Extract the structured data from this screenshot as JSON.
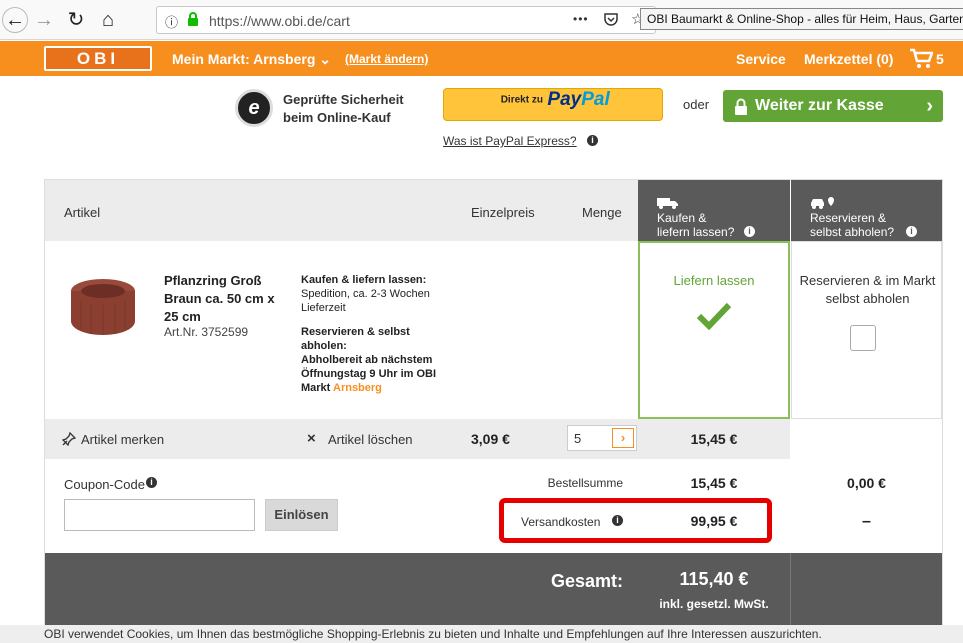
{
  "browser": {
    "url": "https://www.obi.de/cart",
    "tab_tooltip": "OBI Baumarkt & Online-Shop - alles für Heim, Haus, Garten",
    "back_glyph": "←",
    "forward_glyph": "→",
    "reload_glyph": "↻",
    "home_glyph": "⌂",
    "menu_glyph": "•••"
  },
  "header": {
    "logo_text": "OBI",
    "market_label": "Mein Markt: Arnsberg",
    "change_market": "(Markt ändern)",
    "service": "Service",
    "wishlist": "Merkzettel (0)",
    "cart_count": "5",
    "accent_color": "#f78f1e"
  },
  "checkout_bar": {
    "secure_text": "Geprüfte Sicherheit\nbeim Online-Kauf",
    "badge_letter": "e",
    "paypal_prefix": "Direkt zu",
    "paypal_brand_1": "Pay",
    "paypal_brand_2": "Pal",
    "paypal_link": "Was ist PayPal Express?",
    "oder": "oder",
    "checkout_label": "Weiter zur Kasse",
    "checkout_arrow": "›",
    "checkout_color": "#62a435"
  },
  "table": {
    "headers": {
      "artikel": "Artikel",
      "einzelpreis": "Einzelpreis",
      "menge": "Menge",
      "delivery_1": "Kaufen &",
      "delivery_2": "liefern lassen?",
      "pickup_1": "Reservieren &",
      "pickup_2": "selbst abholen?"
    },
    "product": {
      "name": "Pflanzring Groß Braun ca. 50 cm x 25 cm",
      "article_no": "Art.Nr. 3752599",
      "delivery_title": "Kaufen & liefern lassen:",
      "delivery_text": "Spedition, ca. 2-3 Wochen Lieferzeit",
      "pickup_title": "Reservieren & selbst abholen:",
      "pickup_text": "Abholbereit ab nächstem Öffnungstag 9 Uhr im OBI Markt",
      "pickup_market": "Arnsberg",
      "option_delivery": "Liefern lassen",
      "option_pickup": "Reservieren & im Markt selbst abholen",
      "delivery_selected": true
    },
    "actions": {
      "remember": "Artikel merken",
      "delete": "Artikel löschen",
      "unit_price": "3,09 €",
      "quantity": "5",
      "line_total": "15,45 €"
    },
    "summary": {
      "coupon_label": "Coupon-Code",
      "coupon_value": "",
      "redeem": "Einlösen",
      "order_sum_label": "Bestellsumme",
      "order_sum": "15,45 €",
      "pickup_sum": "0,00 €",
      "shipping_label": "Versandkosten",
      "shipping": "99,95 €",
      "pickup_shipping": "–",
      "total_label": "Gesamt:",
      "total": "115,40 €",
      "vat_note": "inkl. gesetzl. MwSt."
    }
  },
  "cookie_text": "OBI verwendet Cookies, um Ihnen das bestmögliche Shopping-Erlebnis zu bieten und Inhalte und Empfehlungen auf Ihre Interessen auszurichten."
}
